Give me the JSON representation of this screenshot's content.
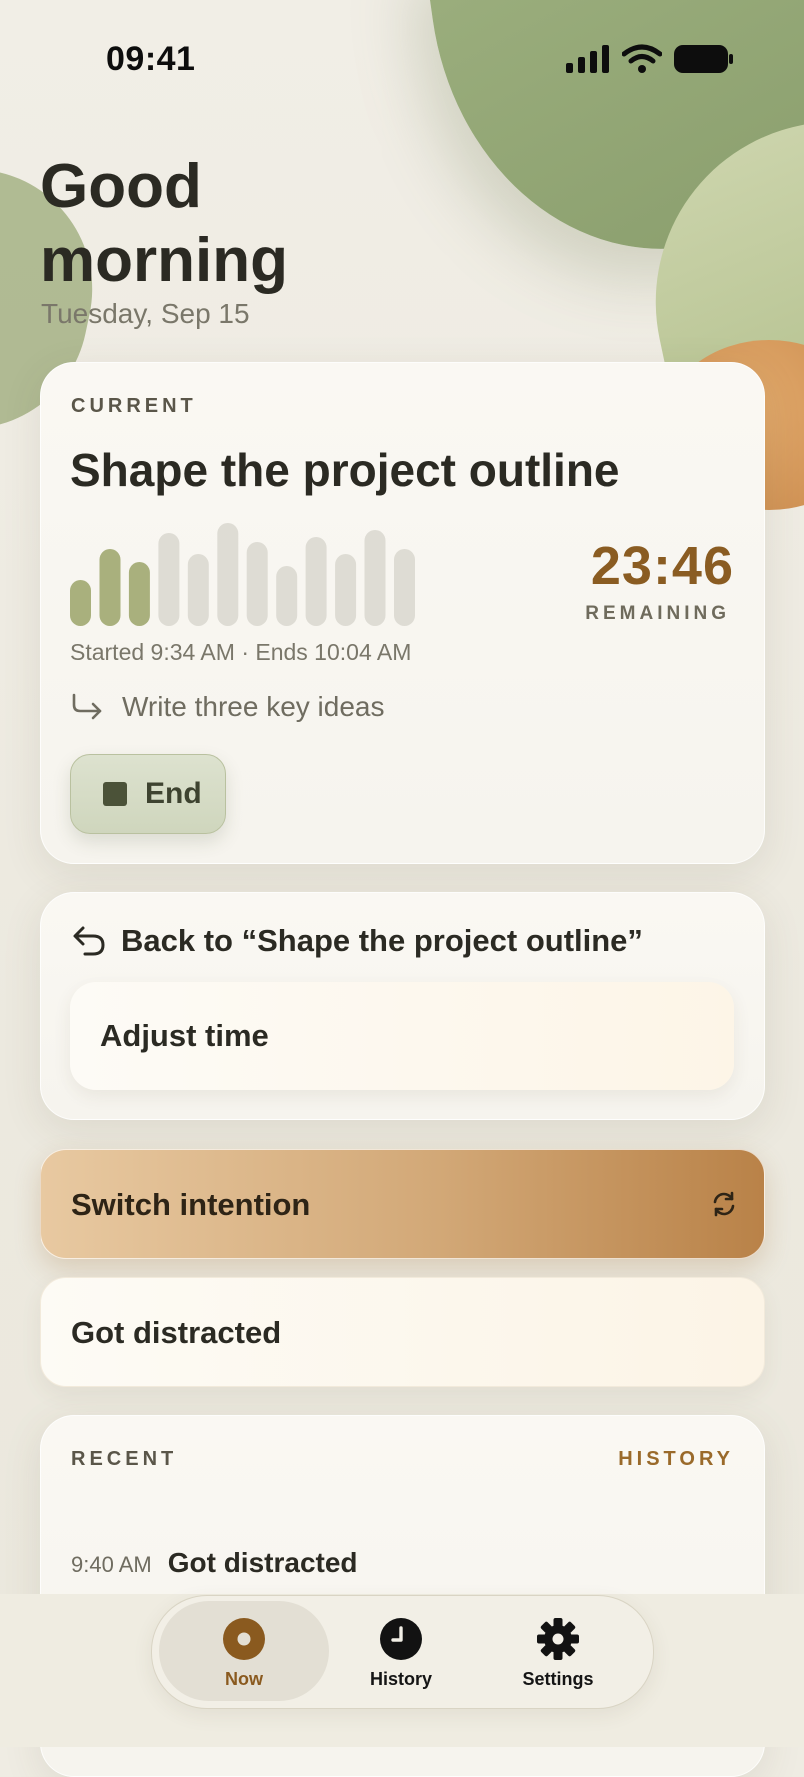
{
  "status_bar": {
    "time": "09:41"
  },
  "greeting": {
    "line1": "Good",
    "line2": "morning",
    "date": "Tuesday, Sep 15"
  },
  "current": {
    "eyebrow": "CURRENT",
    "title": "Shape the project outline",
    "countdown": "23:46",
    "remaining_label": "REMAINING",
    "times": "Started 9:34 AM · Ends 10:04 AM",
    "next_step": "Write three key ideas",
    "end_label": "End",
    "progress_bars": [
      {
        "level": 0.45,
        "done": true
      },
      {
        "level": 0.75,
        "done": true
      },
      {
        "level": 0.62,
        "done": true
      },
      {
        "level": 0.9,
        "done": false
      },
      {
        "level": 0.7,
        "done": false
      },
      {
        "level": 1.0,
        "done": false
      },
      {
        "level": 0.82,
        "done": false
      },
      {
        "level": 0.58,
        "done": false
      },
      {
        "level": 0.86,
        "done": false
      },
      {
        "level": 0.7,
        "done": false
      },
      {
        "level": 0.93,
        "done": false
      },
      {
        "level": 0.75,
        "done": false
      }
    ]
  },
  "back": {
    "label": "Back to “Shape the project outline”",
    "adjust_label": "Adjust time"
  },
  "switch": {
    "label": "Switch intention"
  },
  "distracted": {
    "label": "Got distracted"
  },
  "recent": {
    "eyebrow": "RECENT",
    "history_link": "HISTORY",
    "items": [
      {
        "time": "9:40 AM",
        "text": "Got distracted"
      }
    ]
  },
  "tabs": [
    {
      "label": "Now",
      "icon": "now-icon",
      "active": true
    },
    {
      "label": "History",
      "icon": "clock-icon",
      "active": false
    },
    {
      "label": "Settings",
      "icon": "gear-icon",
      "active": false
    }
  ],
  "colors": {
    "accent": "#8a5c22",
    "bar_done": "#a9b07d",
    "bar_todo": "#dedcd4",
    "leaf": "#9caf7e",
    "switch_gradient_end": "#b98248"
  }
}
